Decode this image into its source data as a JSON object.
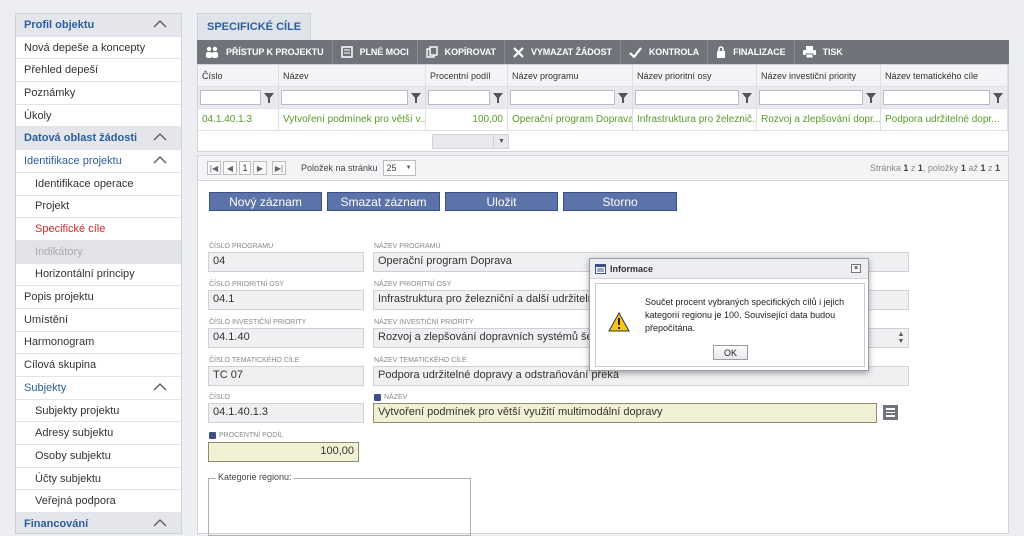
{
  "sidebar": {
    "sections": [
      {
        "label": "Profil objektu",
        "type": "head",
        "chev": true
      },
      {
        "label": "Nová depeše a koncepty",
        "type": "item"
      },
      {
        "label": "Přehled depeší",
        "type": "item"
      },
      {
        "label": "Poznámky",
        "type": "item"
      },
      {
        "label": "Úkoly",
        "type": "item"
      },
      {
        "label": "Datová oblast žádosti",
        "type": "head",
        "chev": true
      },
      {
        "label": "Identifikace projektu",
        "type": "group",
        "chev": true
      },
      {
        "label": "Identifikace operace",
        "type": "sub"
      },
      {
        "label": "Projekt",
        "type": "sub"
      },
      {
        "label": "Specifické cíle",
        "type": "sub-active"
      },
      {
        "label": "Indikátory",
        "type": "sub-disabled"
      },
      {
        "label": "Horizontální principy",
        "type": "sub"
      },
      {
        "label": "Popis projektu",
        "type": "item"
      },
      {
        "label": "Umístění",
        "type": "item"
      },
      {
        "label": "Harmonogram",
        "type": "item"
      },
      {
        "label": "Cílová skupina",
        "type": "item"
      },
      {
        "label": "Subjekty",
        "type": "group",
        "chev": true
      },
      {
        "label": "Subjekty projektu",
        "type": "sub"
      },
      {
        "label": "Adresy subjektu",
        "type": "sub"
      },
      {
        "label": "Osoby subjektu",
        "type": "sub"
      },
      {
        "label": "Účty subjektu",
        "type": "sub"
      },
      {
        "label": "Veřejná podpora",
        "type": "sub"
      },
      {
        "label": "Financování",
        "type": "head",
        "chev": true
      }
    ]
  },
  "tab": {
    "label": "SPECIFICKÉ CÍLE"
  },
  "toolbar": {
    "access": "PŘÍSTUP K PROJEKTU",
    "power": "PLNÉ MOCI",
    "copy": "KOPÍROVAT",
    "delete": "VYMAZAT ŽÁDOST",
    "check": "KONTROLA",
    "finalize": "FINALIZACE",
    "print": "TISK"
  },
  "grid": {
    "columns": [
      "Číslo",
      "Název",
      "Procentní podíl",
      "Název programu",
      "Název prioritní osy",
      "Název investiční priority",
      "Název tematického cíle"
    ],
    "row": [
      "04.1.40.1.3",
      "Vytvoření podmínek pro větší v...",
      "100,00",
      "Operační program Doprava",
      "Infrastruktura pro železnič...",
      "Rozvoj a zlepšování dopr...",
      "Podpora udržitelné dopr..."
    ]
  },
  "pager": {
    "page": "1",
    "per_page_label": "Položek na stránku",
    "per_page": "25",
    "summary_a": "Stránka ",
    "summary_b": "1",
    "summary_c": " z ",
    "summary_d": "1",
    "summary_e": ", položky ",
    "summary_f": "1",
    "summary_g": " až ",
    "summary_h": "1",
    "summary_i": " z ",
    "summary_j": "1"
  },
  "actions": {
    "new": "Nový záznam",
    "delete": "Smazat záznam",
    "save": "Uložit",
    "cancel": "Storno"
  },
  "form": {
    "program_no_label": "ČÍSLO PROGRAMU",
    "program_no": "04",
    "program_name_label": "NÁZEV PROGRAMU",
    "program_name": "Operační program Doprava",
    "axis_no_label": "ČÍSLO PRIORITNÍ OSY",
    "axis_no": "04.1",
    "axis_name_label": "NÁZEV PRIORITNÍ OSY",
    "axis_name": "Infrastruktura pro železniční a další udržitelnou do",
    "priority_no_label": "ČÍSLO INVESTIČNÍ PRIORITY",
    "priority_no": "04.1.40",
    "priority_name_label": "NÁZEV INVESTIČNÍ PRIORITY",
    "priority_name": "Rozvoj a zlepšování dopravních systémů šetrnějš",
    "goal_no_label": "ČÍSLO TEMATICKÉHO CÍLE",
    "goal_no": "TC 07",
    "goal_name_label": "NÁZEV TEMATICKÉHO CÍLE",
    "goal_name": "Podpora udržitelné dopravy a odstraňování překá",
    "number_label": "ČÍSLO",
    "number": "04.1.40.1.3",
    "name_label": "NÁZEV",
    "name": "Vytvoření podmínek pro větší využití multimodální dopravy",
    "share_label": "PROCENTNÍ PODÍL",
    "share": "100,00",
    "region_legend": "Kategorie regionu:"
  },
  "modal": {
    "title": "Informace",
    "message": "Součet procent vybraných specifických cílů i jejich kategorií regionu je 100. Související data budou přepočítána.",
    "ok": "OK"
  },
  "colors": {
    "accent": "#2b5e9e",
    "active": "#cc2a2a",
    "button": "#5b73a8",
    "toolbar": "#6f737a",
    "row_text": "#5a9a28"
  }
}
